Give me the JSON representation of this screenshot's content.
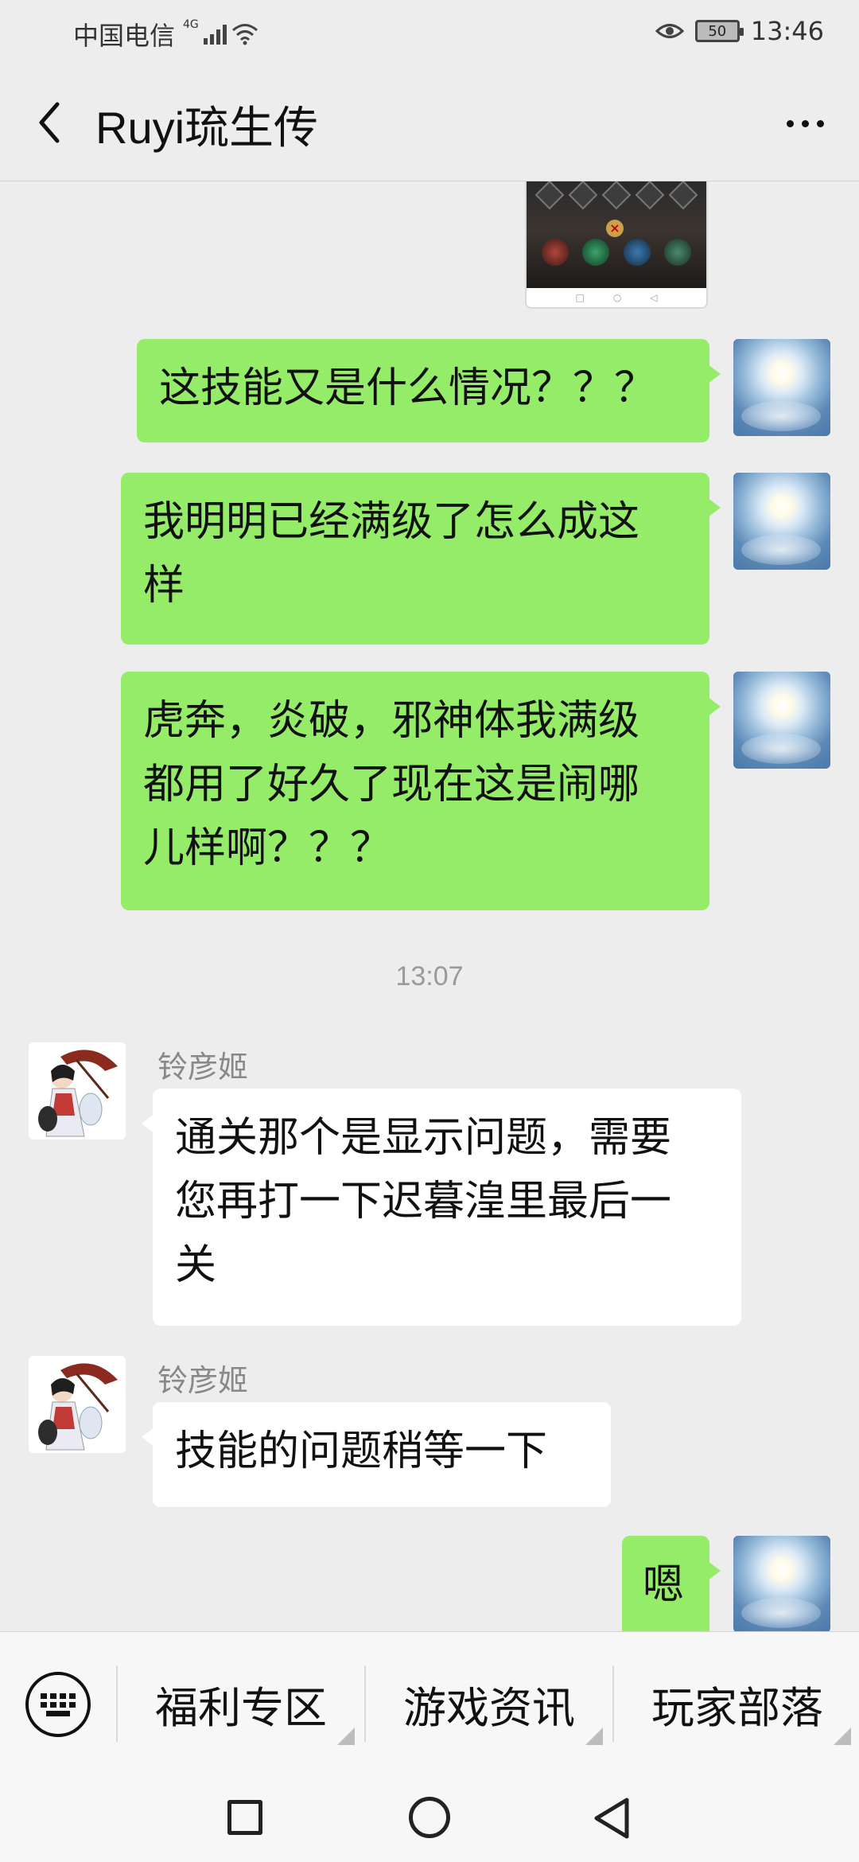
{
  "status_bar": {
    "carrier": "中国电信",
    "network": "4G",
    "battery": "50",
    "time": "13:46"
  },
  "header": {
    "back_icon": "chevron-left-icon",
    "title": "Ruyi琉生传",
    "more_icon": "more-dots-icon"
  },
  "messages": [
    {
      "side": "me",
      "type": "image",
      "description": ""
    },
    {
      "side": "me",
      "type": "text",
      "text": "这技能又是什么情况？？？"
    },
    {
      "side": "me",
      "type": "text",
      "text_lines": [
        "我明明已经满级了怎么成这",
        "样"
      ]
    },
    {
      "side": "me",
      "type": "text",
      "text_lines": [
        "虎奔，炎破，邪神体我满级",
        "都用了好久了现在这是闹哪",
        "儿样啊？？？"
      ]
    },
    {
      "type": "timestamp",
      "text": "13:07"
    },
    {
      "side": "other",
      "type": "text",
      "sender": "铃彦姬",
      "text_lines": [
        "通关那个是显示问题，需要",
        "您再打一下迟暮湟里最后一",
        "关"
      ]
    },
    {
      "side": "other",
      "type": "text",
      "sender": "铃彦姬",
      "text": "技能的问题稍等一下"
    },
    {
      "side": "me",
      "type": "text",
      "text": "嗯"
    }
  ],
  "menu_bar": {
    "keyboard_icon": "keyboard-icon",
    "items": [
      {
        "label": "福利专区"
      },
      {
        "label": "游戏资讯"
      },
      {
        "label": "玩家部落"
      }
    ]
  },
  "nav_bar": {
    "recents_icon": "square-recents-icon",
    "home_icon": "circle-home-icon",
    "back_icon": "triangle-back-icon"
  },
  "colors": {
    "my_bubble": "#95ec69",
    "other_bubble": "#ffffff",
    "background": "#ededed"
  }
}
